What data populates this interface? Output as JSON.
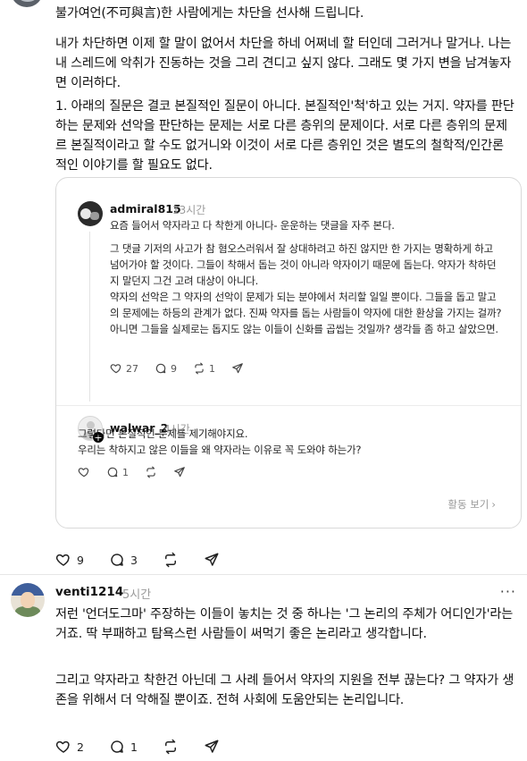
{
  "top_post": {
    "paragraphs": [
      "불가여언(不可與言)한 사람에게는 차단을 선사해 드립니다.",
      "내가 차단하면 이제 할 말이 없어서 차단을 하네 어쩌네 할 터인데 그러거나 말거나. 나는 내 스레드에 악취가 진동하는 것을 그리 견디고 싶지 않다. 그래도 몇 가지 변을 남겨놓자면 이러하다.",
      "1. 아래의 질문은 결코 본질적인 질문이 아니다. 본질적인'척'하고 있는 거지. 약자를 판단하는 문제와 선악을 판단하는 문제는 서로 다른 층위의 문제이다. 서로 다른 층위의 문제르 본질적이라고 할 수도 없거니와 이것이 서로 다른 층위인 것은 별도의 철학적/인간론적인 이야기를 할 필요도 없다."
    ],
    "actions": {
      "likes": "9",
      "replies": "3"
    }
  },
  "quote": {
    "first": {
      "username": "admiral815",
      "time": "13시간",
      "paragraphs": [
        "요즘 들어서 약자라고 다 착한게 아니다- 운운하는 댓글을 자주 본다.",
        "그 댓글 기저의 사고가 참 혐오스러워서 잘 상대하려고 하진 않지만 한 가지는 명확하게 하고 넘어가야 할 것이다. 그들이 착해서 돕는 것이 아니라 약자이기 때문에 돕는다. 약자가 착하던지 말던지 그건 고려 대상이 아니다.",
        "약자의 선악은 그 약자의 선악이 문제가 되는 분야에서 처리할 일일 뿐이다. 그들을 돕고 말고의 문제에는 하등의 관계가 없다. 진짜 약자를 돕는 사람들이 약자에 대한 환상을 가지는 걸까? 아니면 그들을 실제로는 돕지도 않는 이들이 신화를 곱씹는 것일까? 생각들 좀 하고 살았으면."
      ],
      "likes": "27",
      "replies": "9",
      "reposts": "1"
    },
    "second": {
      "username": "walwar_2",
      "time": "4시간",
      "paragraphs": [
        "그렇다면 본질적인 문제를 제기해야지요.\n우리는 착하지고 않은 이들을 왜 약자라는 이유로 꼭 도와야 하는가?"
      ],
      "replies": "1"
    },
    "activity_label": "활동 보기",
    "activity_chevron": "›"
  },
  "reply": {
    "username": "venti1214",
    "time": "5시간",
    "more_label": "···",
    "paragraphs": [
      "저런 '언더도그마' 주장하는 이들이 놓치는 것 중 하나는 '그 논리의 주체가 어디인가'라는 거죠. 딱 부패하고 탐욕스런 사람들이 써먹기 좋은 논리라고 생각합니다.",
      "그리고 약자라고 착한건 아닌데 그 사례 들어서 약자의 지원을 전부 끊는다? 그 약자가 생존을 위해서 더 악해질 뿐이죠. 전혀 사회에 도움안되는 논리입니다."
    ],
    "actions": {
      "likes": "2",
      "replies": "1"
    }
  },
  "icons": {
    "like": "heart-icon",
    "reply": "comment-icon",
    "repost": "repost-icon",
    "share": "send-icon"
  }
}
